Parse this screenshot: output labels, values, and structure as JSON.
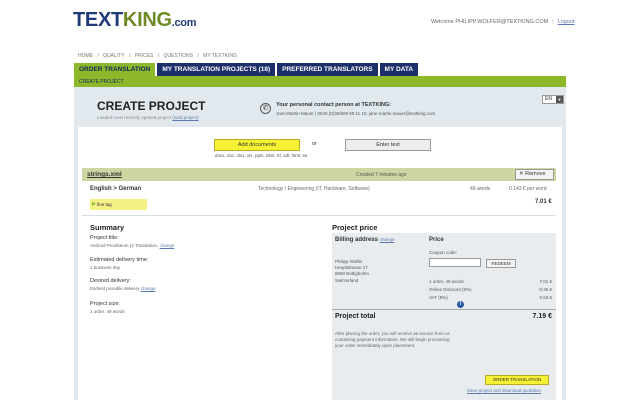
{
  "header": {
    "logo_text": "TEXT",
    "logo_king": "KING",
    "logo_com": ".com",
    "welcome": "Welcome PHILIPP.WOLFER@TEXTKING.COM",
    "separator": "|",
    "logout": "Logout"
  },
  "breadcrumb": [
    "HOME",
    "/",
    "QUALITY",
    "/",
    "PRICES",
    "/",
    "QUESTIONS",
    "/",
    "MY TEXTKING"
  ],
  "tabs": [
    {
      "label": "ORDER TRANSLATION",
      "active": true
    },
    {
      "label": "MY TRANSLATION PROJECTS (18)",
      "active": false
    },
    {
      "label": "PREFERRED TRANSLATORS",
      "active": false
    },
    {
      "label": "MY DATA",
      "active": false
    }
  ],
  "subnav": {
    "label": "CREATE PROJECT"
  },
  "page": {
    "title": "CREATE PROJECT",
    "subtitle": "Loaded most recently opened project",
    "subtitle_link": "(load project)",
    "language": "EN"
  },
  "contact": {
    "icon": "phone-icon",
    "title": "Your personal contact person at TEXTKING:",
    "detail": "Jann-Martin Mauer | 0049 (0)30/609 69 11 10, jann-martin.mauer@textking.com"
  },
  "upload": {
    "add_label": "Add documents",
    "or": "or",
    "enter_text_label": "Enter text",
    "formats": "docx, doc, xlsx, xls, pptx, idml, rtf, sdl, html, txt"
  },
  "file": {
    "name": "strings.xml",
    "time": "Created 7 minutes ago",
    "remove_label": "Remove",
    "language_pair": "English > German",
    "domain": "Technology / Engineering (IT, Hardware, Software)",
    "words": "49 words",
    "rate": "0.143 € per word",
    "price": "7.01 €",
    "fine_tag": "fine tag"
  },
  "summary": {
    "title": "Summary",
    "project_title_label": "Project title:",
    "project_title_value": "Android Prootkeum (4 Translation,",
    "project_title_link": "change",
    "delivery_label": "Estimated delivery time:",
    "delivery_value": "1 business day",
    "desired_label": "Desired delivery:",
    "desired_value": "Earliest possible delivery",
    "desired_link": "change",
    "size_label": "Project size:",
    "size_value": "1 order, 49 words"
  },
  "price": {
    "section_title": "Project price",
    "billing_label": "Billing address",
    "billing_link": "change",
    "price_label": "Price",
    "address_lines": [
      "Philipp Wolfer",
      "Heuptstrasse 17",
      "8590 Bottighofen",
      "Switzerland"
    ],
    "coupon_label": "Coupon code:",
    "coupon_value": "",
    "redeem_label": "REDEEM",
    "lines": [
      {
        "label": "1 order, 49 words",
        "amount": "7.01 €"
      },
      {
        "label": "Online Discount (5%)",
        "amount": "-0.35 €"
      },
      {
        "label": "VAT (8%)",
        "amount": "0.53 €"
      }
    ],
    "total_label": "Project total",
    "total_amount": "7.19 €",
    "disclaimer": "After placing the order, you will receive an invoice from us containing payment information. We will begin processing your order immediately upon placement.",
    "order_label": "ORDER TRANSLATION",
    "save_link": "Save project and download quotation"
  },
  "colors": {
    "navy": "#1d2f6b",
    "green": "#8cb82a",
    "yellow_button": "#f6f233",
    "panel_gray": "#e2e9ee"
  }
}
